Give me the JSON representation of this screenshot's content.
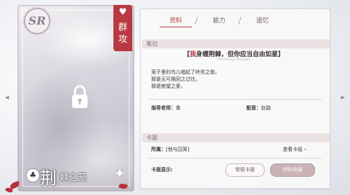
{
  "card": {
    "rarity": "SR",
    "class_label": "群攻",
    "name_first_char": "荆",
    "name_rest": "棘之笼"
  },
  "tabs": [
    {
      "label": "资料",
      "active": true
    },
    {
      "label": "能力",
      "active": false
    },
    {
      "label": "追忆",
      "active": false
    }
  ],
  "notes": {
    "header": "笔记",
    "quote_highlight": "我",
    "quote_rest": "身缠荆棘，但你应当自由如星",
    "quote_subtitle": "Drowning Thought",
    "story_lines": [
      "笼子里的鸟儿唱起了终焉之歌。",
      "那是无可挽回之过往。",
      "那是绝望之爱。"
    ],
    "mentor_label": "指导老师：",
    "mentor_value": "禽",
    "voice_label": "配音：",
    "voice_value": "赵路"
  },
  "face": {
    "header": "卡面",
    "belong_label": "所属：",
    "belong_value": "[他与囚笼]",
    "view_group": "查看卡组",
    "display_label": "卡面显示:",
    "normal_button": "常规卡面",
    "evolve_button": "终阶突破"
  },
  "colors": {
    "accent": "#b73a42",
    "panel_bg": "#faf8f9",
    "section_bg": "#e9e1e2"
  }
}
